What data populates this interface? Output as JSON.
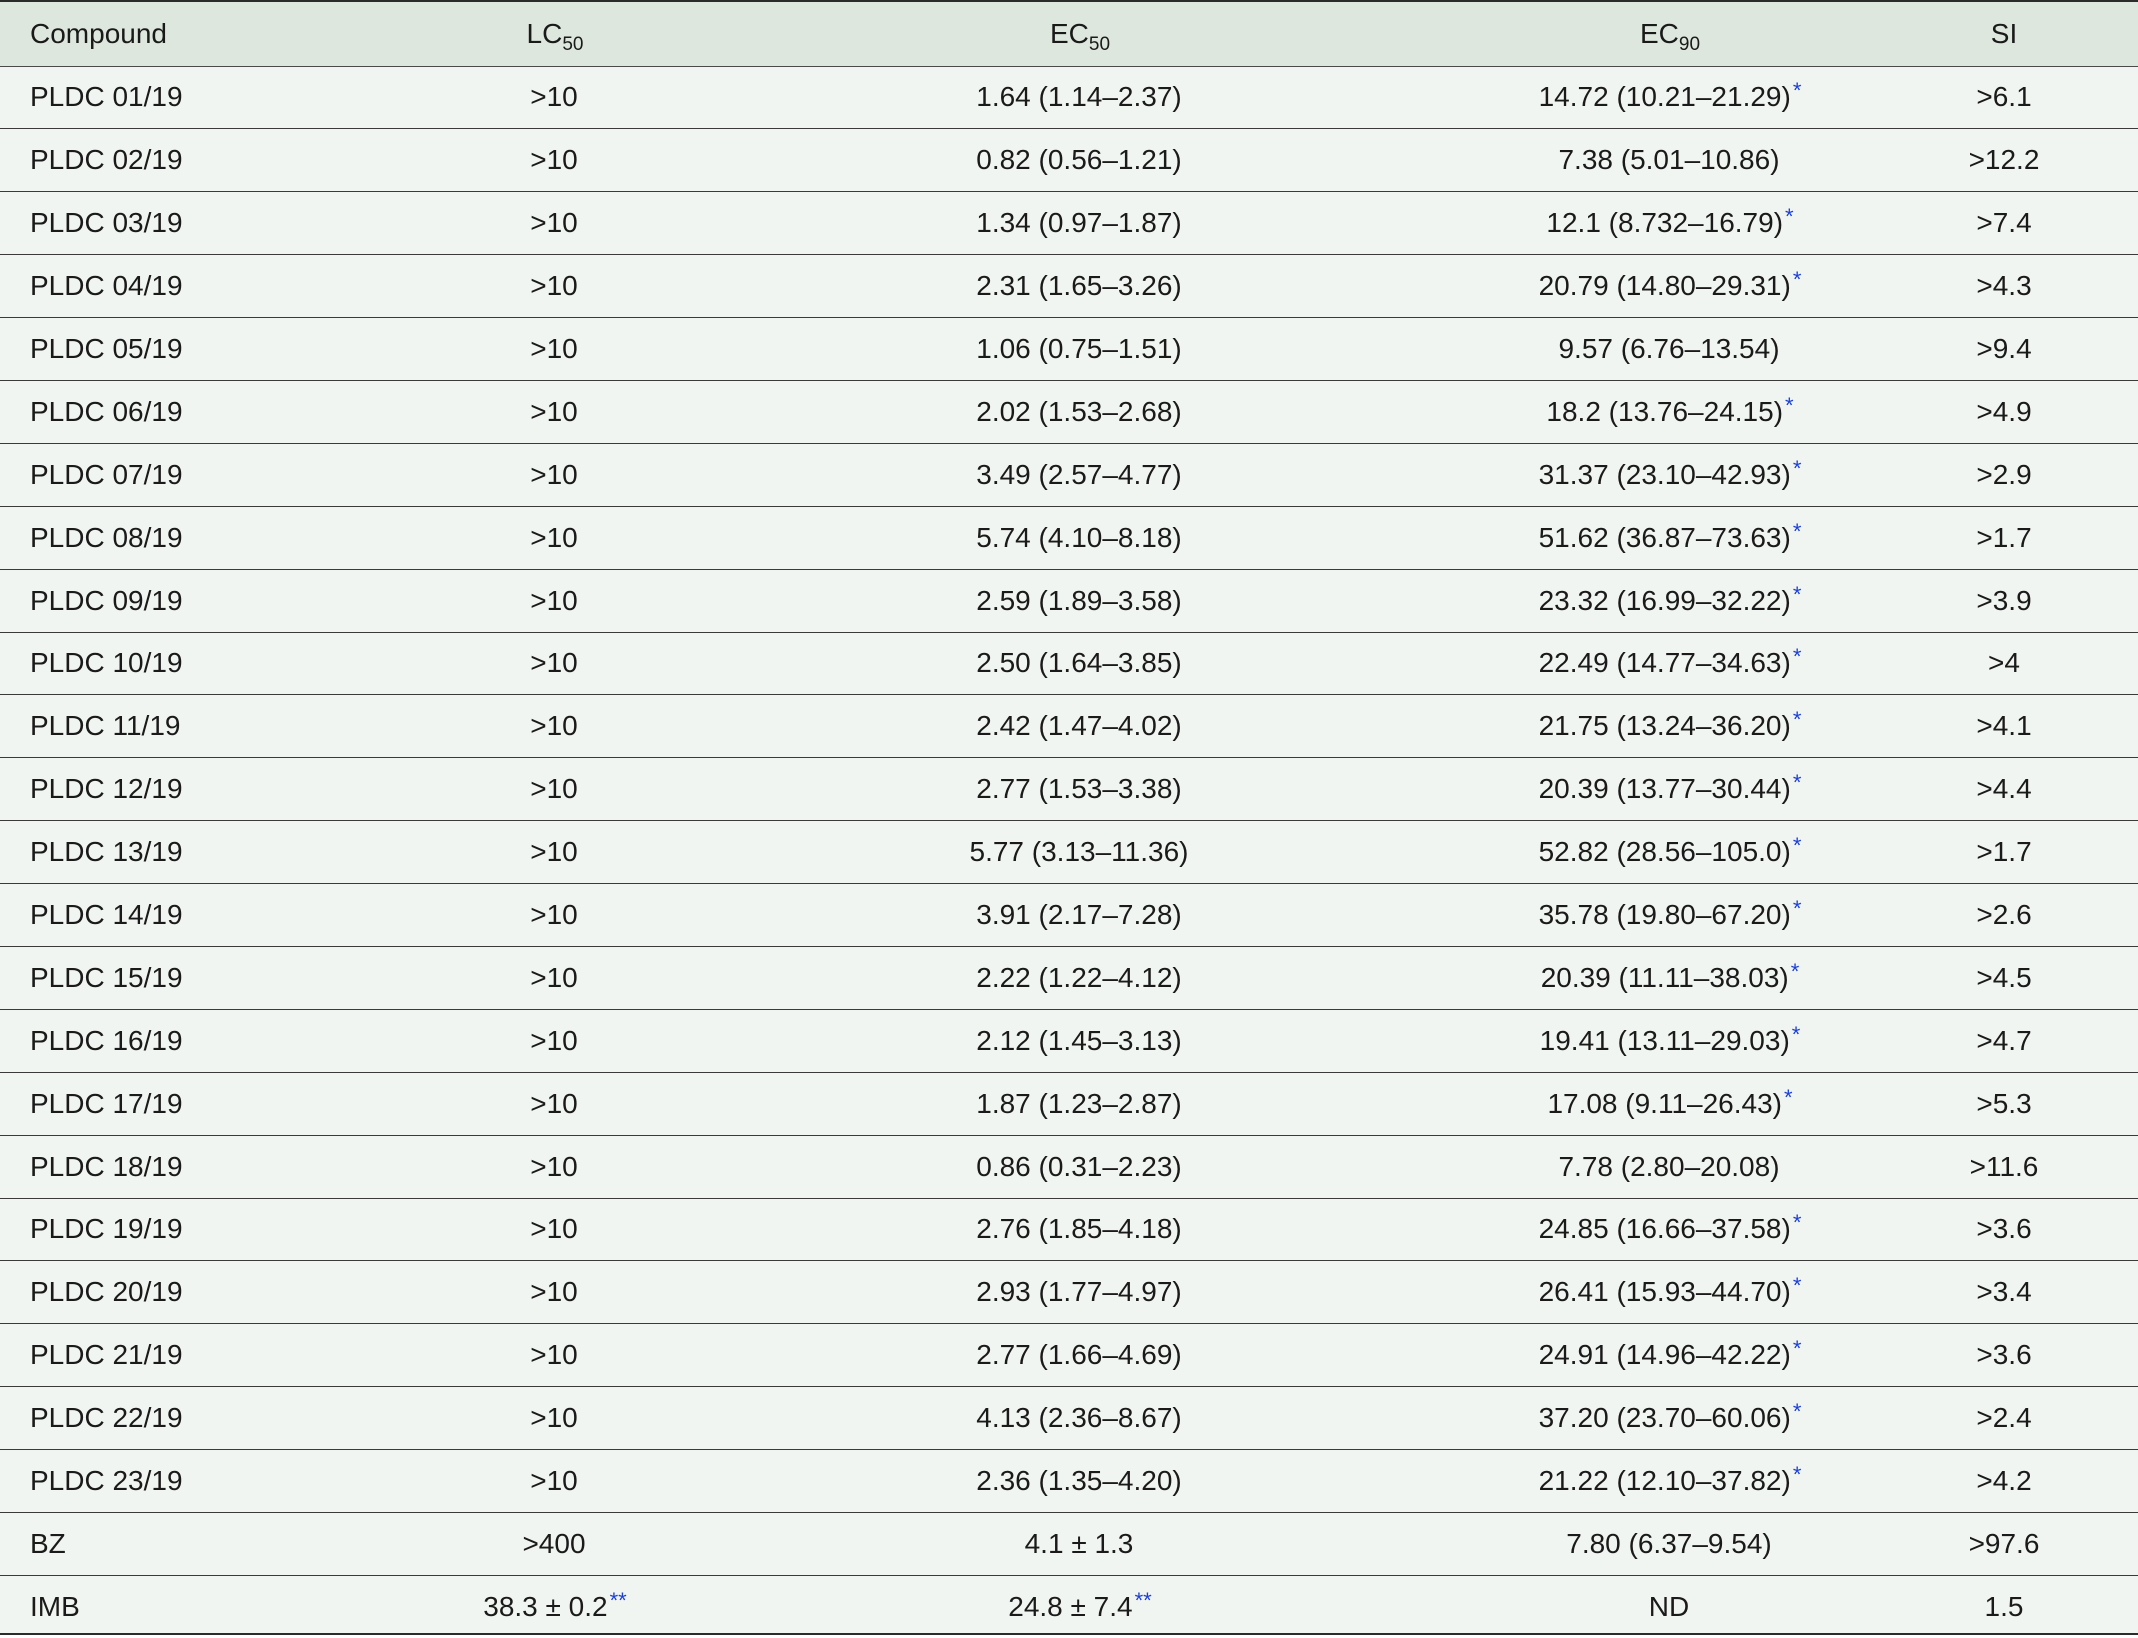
{
  "table": {
    "headers": {
      "compound": "Compound",
      "lc": {
        "base": "LC",
        "sub": "50"
      },
      "ec50": {
        "base": "EC",
        "sub": "50"
      },
      "ec90": {
        "base": "EC",
        "sub": "90"
      },
      "si": "SI"
    },
    "rows": [
      {
        "compound": "PLDC 01/19",
        "lc50": ">10",
        "ec50": "1.64 (1.14–2.37)",
        "ec50_mark": "",
        "ec90": "14.72 (10.21–21.29)",
        "ec90_mark": "*",
        "si": ">6.1"
      },
      {
        "compound": "PLDC 02/19",
        "lc50": ">10",
        "ec50": "0.82 (0.56–1.21)",
        "ec50_mark": "",
        "ec90": "7.38 (5.01–10.86)",
        "ec90_mark": "",
        "si": ">12.2"
      },
      {
        "compound": "PLDC 03/19",
        "lc50": ">10",
        "ec50": "1.34 (0.97–1.87)",
        "ec50_mark": "",
        "ec90": "12.1 (8.732–16.79)",
        "ec90_mark": "*",
        "si": ">7.4"
      },
      {
        "compound": "PLDC 04/19",
        "lc50": ">10",
        "ec50": "2.31 (1.65–3.26)",
        "ec50_mark": "",
        "ec90": "20.79 (14.80–29.31)",
        "ec90_mark": "*",
        "si": ">4.3"
      },
      {
        "compound": "PLDC 05/19",
        "lc50": ">10",
        "ec50": "1.06 (0.75–1.51)",
        "ec50_mark": "",
        "ec90": "9.57 (6.76–13.54)",
        "ec90_mark": "",
        "si": ">9.4"
      },
      {
        "compound": "PLDC 06/19",
        "lc50": ">10",
        "ec50": "2.02 (1.53–2.68)",
        "ec50_mark": "",
        "ec90": "18.2 (13.76–24.15)",
        "ec90_mark": "*",
        "si": ">4.9"
      },
      {
        "compound": "PLDC 07/19",
        "lc50": ">10",
        "ec50": "3.49 (2.57–4.77)",
        "ec50_mark": "",
        "ec90": "31.37 (23.10–42.93)",
        "ec90_mark": "*",
        "si": ">2.9"
      },
      {
        "compound": "PLDC 08/19",
        "lc50": ">10",
        "ec50": "5.74 (4.10–8.18)",
        "ec50_mark": "",
        "ec90": "51.62 (36.87–73.63)",
        "ec90_mark": "*",
        "si": ">1.7"
      },
      {
        "compound": "PLDC 09/19",
        "lc50": ">10",
        "ec50": "2.59 (1.89–3.58)",
        "ec50_mark": "",
        "ec90": "23.32 (16.99–32.22)",
        "ec90_mark": "*",
        "si": ">3.9"
      },
      {
        "compound": "PLDC 10/19",
        "lc50": ">10",
        "ec50": "2.50 (1.64–3.85)",
        "ec50_mark": "",
        "ec90": "22.49 (14.77–34.63)",
        "ec90_mark": "*",
        "si": ">4"
      },
      {
        "compound": "PLDC 11/19",
        "lc50": ">10",
        "ec50": "2.42 (1.47–4.02)",
        "ec50_mark": "",
        "ec90": "21.75 (13.24–36.20)",
        "ec90_mark": "*",
        "si": ">4.1"
      },
      {
        "compound": "PLDC 12/19",
        "lc50": ">10",
        "ec50": "2.77 (1.53–3.38)",
        "ec50_mark": "",
        "ec90": "20.39 (13.77–30.44)",
        "ec90_mark": "*",
        "si": ">4.4"
      },
      {
        "compound": "PLDC 13/19",
        "lc50": ">10",
        "ec50": "5.77 (3.13–11.36)",
        "ec50_mark": "",
        "ec90": "52.82 (28.56–105.0)",
        "ec90_mark": "*",
        "si": ">1.7"
      },
      {
        "compound": "PLDC 14/19",
        "lc50": ">10",
        "ec50": "3.91 (2.17–7.28)",
        "ec50_mark": "",
        "ec90": "35.78 (19.80–67.20)",
        "ec90_mark": "*",
        "si": ">2.6"
      },
      {
        "compound": "PLDC 15/19",
        "lc50": ">10",
        "ec50": "2.22 (1.22–4.12)",
        "ec50_mark": "",
        "ec90": "20.39 (11.11–38.03)",
        "ec90_mark": "*",
        "si": ">4.5"
      },
      {
        "compound": "PLDC 16/19",
        "lc50": ">10",
        "ec50": "2.12 (1.45–3.13)",
        "ec50_mark": "",
        "ec90": "19.41 (13.11–29.03)",
        "ec90_mark": "*",
        "si": ">4.7"
      },
      {
        "compound": "PLDC 17/19",
        "lc50": ">10",
        "ec50": "1.87 (1.23–2.87)",
        "ec50_mark": "",
        "ec90": "17.08 (9.11–26.43)",
        "ec90_mark": "*",
        "si": ">5.3"
      },
      {
        "compound": "PLDC 18/19",
        "lc50": ">10",
        "ec50": "0.86 (0.31–2.23)",
        "ec50_mark": "",
        "ec90": "7.78 (2.80–20.08)",
        "ec90_mark": "",
        "si": ">11.6"
      },
      {
        "compound": "PLDC 19/19",
        "lc50": ">10",
        "ec50": "2.76 (1.85–4.18)",
        "ec50_mark": "",
        "ec90": "24.85 (16.66–37.58)",
        "ec90_mark": "*",
        "si": ">3.6"
      },
      {
        "compound": "PLDC 20/19",
        "lc50": ">10",
        "ec50": "2.93 (1.77–4.97)",
        "ec50_mark": "",
        "ec90": "26.41 (15.93–44.70)",
        "ec90_mark": "*",
        "si": ">3.4"
      },
      {
        "compound": "PLDC 21/19",
        "lc50": ">10",
        "ec50": "2.77 (1.66–4.69)",
        "ec50_mark": "",
        "ec90": "24.91 (14.96–42.22)",
        "ec90_mark": "*",
        "si": ">3.6"
      },
      {
        "compound": "PLDC 22/19",
        "lc50": ">10",
        "ec50": "4.13 (2.36–8.67)",
        "ec50_mark": "",
        "ec90": "37.20 (23.70–60.06)",
        "ec90_mark": "*",
        "si": ">2.4"
      },
      {
        "compound": "PLDC 23/19",
        "lc50": ">10",
        "ec50": "2.36 (1.35–4.20)",
        "ec50_mark": "",
        "ec90": "21.22 (12.10–37.82)",
        "ec90_mark": "*",
        "si": ">4.2"
      },
      {
        "compound": "BZ",
        "lc50": ">400",
        "lc50_mark": "",
        "ec50": "4.1 ± 1.3",
        "ec50_mark": "",
        "ec90": "7.80 (6.37–9.54)",
        "ec90_mark": "",
        "si": ">97.6"
      },
      {
        "compound": "IMB",
        "lc50": "38.3 ± 0.2",
        "lc50_mark": "**",
        "ec50": "24.8 ± 7.4",
        "ec50_mark": "**",
        "ec90": "ND",
        "ec90_mark": "",
        "si": "1.5"
      }
    ]
  },
  "colors": {
    "header_bg": "#dde7dd",
    "body_bg": "#f1f5f1",
    "footnote_mark": "#1a3fd6",
    "rule": "#2b2b2b"
  }
}
